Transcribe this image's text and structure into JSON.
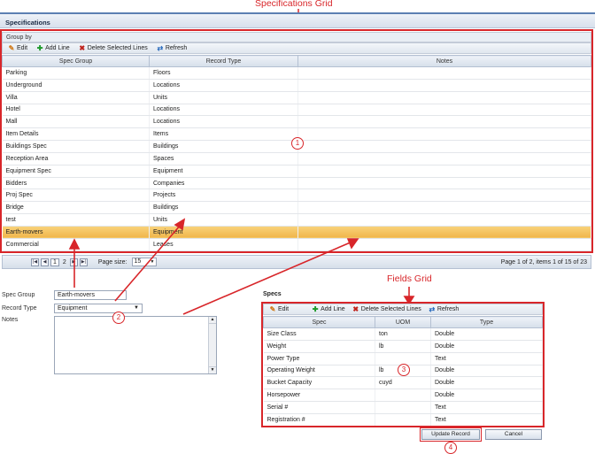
{
  "annotations": {
    "specs_grid_label": "Specifications Grid",
    "fields_grid_label": "Fields Grid",
    "callouts": [
      "1",
      "2",
      "3",
      "4"
    ],
    "color": "#d8262a"
  },
  "panel": {
    "title": "Specifications"
  },
  "spec_grid": {
    "group_by": "Group by",
    "toolbar": {
      "edit": "Edit",
      "add": "Add Line",
      "delete": "Delete Selected Lines",
      "refresh": "Refresh"
    },
    "columns": [
      "Spec Group",
      "Record Type",
      "Notes"
    ],
    "rows": [
      [
        "Parking",
        "Floors",
        ""
      ],
      [
        "Underground",
        "Locations",
        ""
      ],
      [
        "Villa",
        "Units",
        ""
      ],
      [
        "Hotel",
        "Locations",
        ""
      ],
      [
        "Mall",
        "Locations",
        ""
      ],
      [
        "Item Details",
        "Items",
        ""
      ],
      [
        "Buildings Spec",
        "Buildings",
        ""
      ],
      [
        "Reception Area",
        "Spaces",
        ""
      ],
      [
        "Equipment Spec",
        "Equipment",
        ""
      ],
      [
        "Bidders",
        "Companies",
        ""
      ],
      [
        "Proj Spec",
        "Projects",
        ""
      ],
      [
        "Bridge",
        "Buildings",
        ""
      ],
      [
        "test",
        "Units",
        ""
      ],
      [
        "Earth-movers",
        "Equipment",
        ""
      ],
      [
        "Commercial",
        "Leases",
        ""
      ]
    ],
    "selected_row": "Earth-movers",
    "pager": {
      "pages": [
        "1",
        "2"
      ],
      "current": "1",
      "page_size_label": "Page size:",
      "page_size": "15",
      "summary": "Page 1 of 2, items 1 of 15 of 23"
    }
  },
  "form": {
    "spec_group_label": "Spec Group",
    "spec_group_value": "Earth-movers",
    "record_type_label": "Record Type",
    "record_type_value": "Equipment",
    "notes_label": "Notes",
    "notes_value": ""
  },
  "fields_grid": {
    "title": "Specs",
    "toolbar": {
      "edit": "Edit",
      "add": "Add Line",
      "delete": "Delete Selected Lines",
      "refresh": "Refresh"
    },
    "columns": [
      "Spec",
      "UOM",
      "Type"
    ],
    "rows": [
      [
        "Size Class",
        "ton",
        "Double"
      ],
      [
        "Weight",
        "lb",
        "Double"
      ],
      [
        "Power Type",
        "",
        "Text"
      ],
      [
        "Operating Weight",
        "lb",
        "Double"
      ],
      [
        "Bucket Capacity",
        "cuyd",
        "Double"
      ],
      [
        "Horsepower",
        "",
        "Double"
      ],
      [
        "Serial #",
        "",
        "Text"
      ],
      [
        "Registration #",
        "",
        "Text"
      ]
    ]
  },
  "buttons": {
    "update": "Update Record",
    "cancel": "Cancel"
  }
}
